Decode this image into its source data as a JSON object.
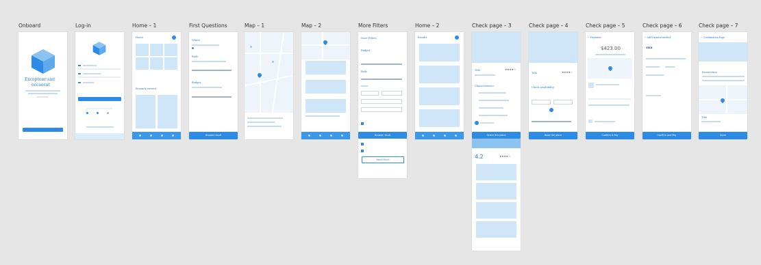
{
  "frames": [
    {
      "label": "Onboard"
    },
    {
      "label": "Log-in"
    },
    {
      "label": "Home – 1"
    },
    {
      "label": "First Questions"
    },
    {
      "label": "Map – 1"
    },
    {
      "label": "Map – 2"
    },
    {
      "label": "More Filters"
    },
    {
      "label": "Home – 2"
    },
    {
      "label": "Check page – 3"
    },
    {
      "label": "Check page – 4"
    },
    {
      "label": "Check page – 5"
    },
    {
      "label": "Check page – 6"
    },
    {
      "label": "Check page – 7"
    }
  ],
  "onboard": {
    "headline_1": "Excepteur sint",
    "headline_2": "occaecat"
  },
  "home1": {
    "title": "Home",
    "recent": "Recently viewed"
  },
  "first_questions": {
    "where": "Where",
    "beds": "Beds",
    "budget": "Budget",
    "button": "Browse result"
  },
  "more_filters": {
    "title": "More Filters",
    "budget": "Budget",
    "beds": "Beds",
    "button": "Browse result",
    "reset": "Reset filters"
  },
  "home2": {
    "title": "Results"
  },
  "check3": {
    "title": "Title",
    "characteristics": "Characteristics",
    "button": "Select this place",
    "rating": "4.2",
    "stars": "★★★★☆",
    "card_stars": "★★★★"
  },
  "check4": {
    "title": "Title",
    "availability": "Check Availability",
    "button": "Book the place",
    "stars": "★★★★☆"
  },
  "check5": {
    "title": "← Payment",
    "price": "$423.00",
    "button": "Confirm & Pay"
  },
  "check6": {
    "title": "← Add Payment method",
    "visa": "VISA",
    "button": "Confirm and Pay"
  },
  "check7": {
    "title": "← Confirmation Page",
    "reservation": "Reservation",
    "item_title": "Title",
    "button": "Done"
  },
  "colors": {
    "canvas": "#e6e6e6",
    "accent": "#2d8be6",
    "placeholder": "#cfe6f8"
  }
}
